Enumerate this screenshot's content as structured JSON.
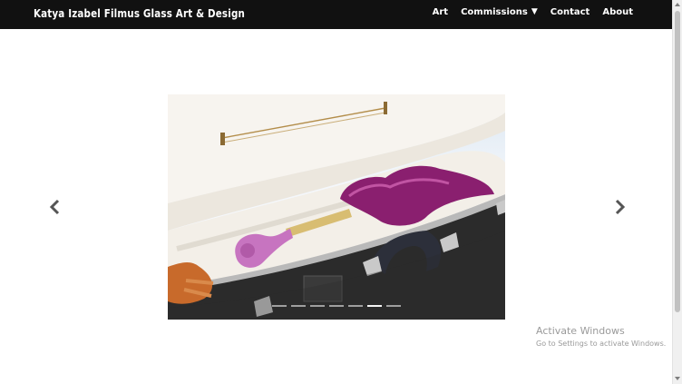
{
  "header": {
    "brand": "Katya Izabel Filmus Glass Art & Design",
    "nav": [
      {
        "label": "Art"
      },
      {
        "label": "Commissions",
        "caret": "▼"
      },
      {
        "label": "Contact"
      },
      {
        "label": "About"
      }
    ]
  },
  "slider": {
    "image_alt": "glass violin in open violin case",
    "prev_icon": "chevron-left-icon",
    "next_icon": "chevron-right-icon",
    "dot_count": 7,
    "active_dot": 5
  },
  "watermark": {
    "title": "Activate Windows",
    "subtitle": "Go to Settings to activate Windows."
  },
  "colors": {
    "header_bg": "#111111",
    "arrow": "#555555"
  }
}
